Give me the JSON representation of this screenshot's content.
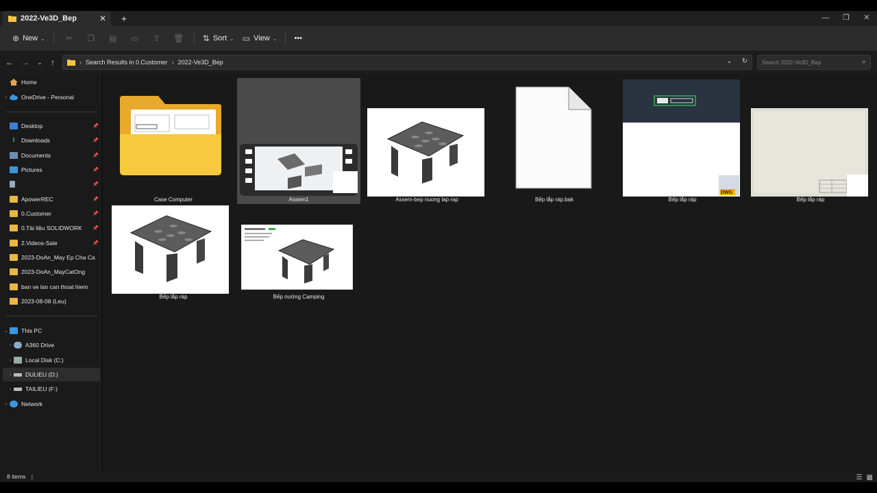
{
  "tab": {
    "title": "2022-Ve3D_Bep",
    "close": "✕"
  },
  "new_tab": "+",
  "window": {
    "minimize": "—",
    "restore": "❐",
    "close": "✕"
  },
  "toolbar": {
    "new_label": "New",
    "sort_label": "Sort",
    "view_label": "View",
    "more_label": "•••"
  },
  "address": {
    "crumb1": "Search Results in 0.Customer",
    "crumb2": "2022-Ve3D_Bep",
    "search_placeholder": "Search 2022-Ve3D_Bep"
  },
  "sidebar": {
    "home": "Home",
    "onedrive": "OneDrive - Personal",
    "pinned": [
      {
        "label": "Desktop"
      },
      {
        "label": "Downloads"
      },
      {
        "label": "Documents"
      },
      {
        "label": "Pictures"
      },
      {
        "label": ""
      },
      {
        "label": "ApowerREC"
      },
      {
        "label": "0.Customer"
      },
      {
        "label": "0.Tài liệu SOLIDWORK"
      },
      {
        "label": "2.Videos-Sale"
      },
      {
        "label": "2023-DoAn_May Ep Cha Ca"
      },
      {
        "label": "2023-DoAn_MayCatOng"
      },
      {
        "label": "ban ve lan can thoat hiem"
      },
      {
        "label": "2023-08-08  (Leu)"
      }
    ],
    "thispc": "This PC",
    "drives": [
      {
        "label": "A360 Drive"
      },
      {
        "label": "Local Disk (C:)"
      },
      {
        "label": "DULIEU (D:)"
      },
      {
        "label": "TAILIEU (F:)"
      }
    ],
    "network": "Network"
  },
  "files": [
    {
      "label": "Case Computer"
    },
    {
      "label": "Assem1"
    },
    {
      "label": "Assem-bep nuong lap rap"
    },
    {
      "label": "Bếp lắp ráp.bak"
    },
    {
      "label": "Bếp lắp ráp"
    },
    {
      "label": "Bếp lắp ráp"
    },
    {
      "label": "Bếp lắp ráp"
    },
    {
      "label": "Bếp nướng Camping"
    }
  ],
  "status": {
    "count": "8 items",
    "cursor": "|"
  },
  "colors": {
    "folder": "#f4c542",
    "accent": "#4cc2ff"
  }
}
